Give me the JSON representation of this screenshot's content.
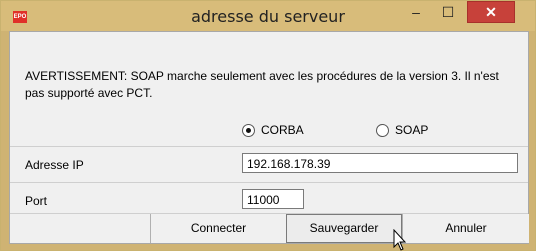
{
  "window": {
    "title": "adresse du serveur",
    "app_icon_text": "EPO",
    "minimize_glyph": "–",
    "maximize_glyph": "☐",
    "close_glyph": "✕",
    "accent_close": "#c7413a"
  },
  "warning": {
    "text": "AVERTISSEMENT: SOAP marche seulement avec les procédures de la version 3. Il n'est pas supporté avec PCT."
  },
  "protocol": {
    "options": [
      {
        "label": "CORBA",
        "selected": true
      },
      {
        "label": "SOAP",
        "selected": false
      }
    ]
  },
  "fields": {
    "ip_label": "Adresse IP",
    "ip_value": "192.168.178.39",
    "port_label": "Port",
    "port_value": "11000"
  },
  "buttons": {
    "connect": "Connecter",
    "save": "Sauvegarder",
    "cancel": "Annuler"
  }
}
